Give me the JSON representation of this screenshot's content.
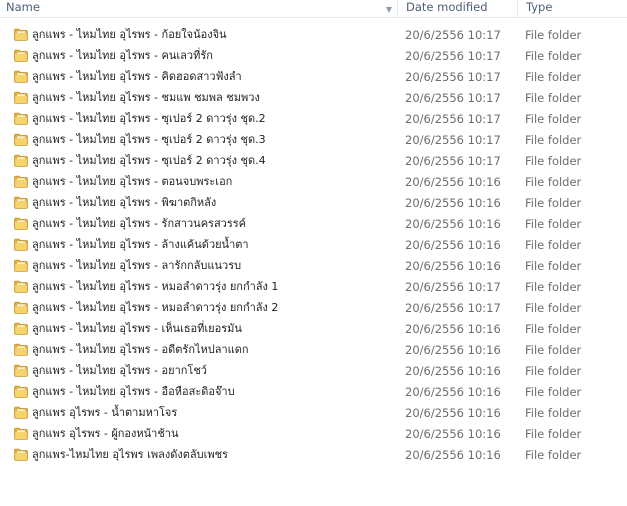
{
  "columns": {
    "name": "Name",
    "date_modified": "Date modified",
    "type": "Type"
  },
  "header_icons": {
    "sort": "chevron-down-icon"
  },
  "row_icon": "folder-icon",
  "rows": [
    {
      "name": "ลูกแพร - ไหมไทย อุไรพร - ก้อยใจน้องจิน",
      "date": "20/6/2556 10:17",
      "type": "File folder"
    },
    {
      "name": "ลูกแพร - ไหมไทย อุไรพร - คนเลวที่รัก",
      "date": "20/6/2556 10:17",
      "type": "File folder"
    },
    {
      "name": "ลูกแพร - ไหมไทย อุไรพร - คิดฮอดสาวฟังลำ",
      "date": "20/6/2556 10:17",
      "type": "File folder"
    },
    {
      "name": "ลูกแพร - ไหมไทย อุไรพร - ชมแพ ชมพล ชมพวง",
      "date": "20/6/2556 10:17",
      "type": "File folder"
    },
    {
      "name": "ลูกแพร - ไหมไทย อุไรพร - ซุเปอร์ 2 ดาวรุ่ง ชุด.2",
      "date": "20/6/2556 10:17",
      "type": "File folder"
    },
    {
      "name": "ลูกแพร - ไหมไทย อุไรพร - ซุเปอร์ 2 ดาวรุ่ง ชุด.3",
      "date": "20/6/2556 10:17",
      "type": "File folder"
    },
    {
      "name": "ลูกแพร - ไหมไทย อุไรพร - ซุเปอร์ 2 ดาวรุ่ง ชุด.4",
      "date": "20/6/2556 10:17",
      "type": "File folder"
    },
    {
      "name": "ลูกแพร - ไหมไทย อุไรพร - ตอนจบพระเอก",
      "date": "20/6/2556 10:16",
      "type": "File folder"
    },
    {
      "name": "ลูกแพร - ไหมไทย อุไรพร - พิฆาตกิหลัง",
      "date": "20/6/2556 10:16",
      "type": "File folder"
    },
    {
      "name": "ลูกแพร - ไหมไทย อุไรพร - รักสาวนครสวรรค์",
      "date": "20/6/2556 10:16",
      "type": "File folder"
    },
    {
      "name": "ลูกแพร - ไหมไทย อุไรพร - ล้างแค้นด้วยน้ำตา",
      "date": "20/6/2556 10:16",
      "type": "File folder"
    },
    {
      "name": "ลูกแพร - ไหมไทย อุไรพร - ลารักกลับแนวรบ",
      "date": "20/6/2556 10:16",
      "type": "File folder"
    },
    {
      "name": "ลูกแพร - ไหมไทย อุไรพร - หมอลำดาวรุ่ง ยกกำลัง 1",
      "date": "20/6/2556 10:17",
      "type": "File folder"
    },
    {
      "name": "ลูกแพร - ไหมไทย อุไรพร - หมอลำดาวรุ่ง ยกกำลัง 2",
      "date": "20/6/2556 10:17",
      "type": "File folder"
    },
    {
      "name": "ลูกแพร - ไหมไทย อุไรพร - เห็นเธอที่เยอรมัน",
      "date": "20/6/2556 10:16",
      "type": "File folder"
    },
    {
      "name": "ลูกแพร - ไหมไทย อุไรพร - อดีตรักไหปลาแดก",
      "date": "20/6/2556 10:16",
      "type": "File folder"
    },
    {
      "name": "ลูกแพร - ไหมไทย อุไรพร - อยากโชว์",
      "date": "20/6/2556 10:16",
      "type": "File folder"
    },
    {
      "name": "ลูกแพร - ไหมไทย อุไรพร - อือหือสะดิอจ๊าบ",
      "date": "20/6/2556 10:16",
      "type": "File folder"
    },
    {
      "name": "ลูกแพร อุไรพร - น้ำตามหาโจร",
      "date": "20/6/2556 10:16",
      "type": "File folder"
    },
    {
      "name": "ลูกแพร อุไรพร - ผู้กองหน้าช้าน",
      "date": "20/6/2556 10:16",
      "type": "File folder"
    },
    {
      "name": "ลูกแพร-ไหมไทย อุไรพร เพลงดังตลับเพชร",
      "date": "20/6/2556 10:16",
      "type": "File folder"
    }
  ]
}
